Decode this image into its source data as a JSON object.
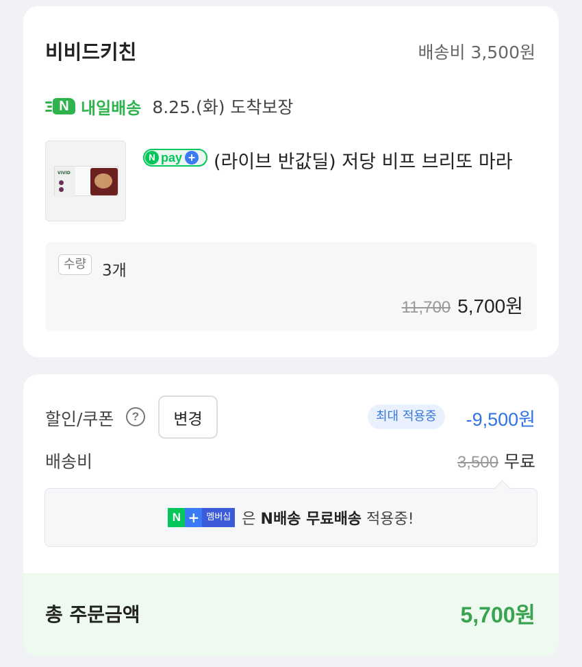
{
  "store": {
    "name": "비비드키친",
    "shipping_fee_label": "배송비 3,500원"
  },
  "delivery": {
    "badge_letter": "N",
    "label": "내일배송",
    "arrival": "8.25.(화) 도착보장",
    "color": "#2fb34c"
  },
  "product": {
    "thumbnail_logo": "VIVID",
    "npay_badge": {
      "n": "N",
      "pay": "pay",
      "plus": "+"
    },
    "title": "(라이브 반값딜) 저당 비프 브리또 마라"
  },
  "quantity": {
    "tag": "수량",
    "value": "3개",
    "original_price": "11,700",
    "final_price": "5,700원"
  },
  "summary": {
    "coupon_label": "할인/쿠폰",
    "help_icon": "?",
    "change_button": "변경",
    "max_badge": "최대 적용중",
    "discount": "-9,500원",
    "shipping_label": "배송비",
    "shipping_original": "3,500",
    "shipping_free": "무료"
  },
  "membership": {
    "n": "N",
    "plus": "+",
    "badge": "멤버십",
    "text_pre": "은",
    "text_bold": "N배송 무료배송",
    "text_post": "적용중!"
  },
  "total": {
    "label": "총 주문금액",
    "value": "5,700원",
    "color": "#3aa34f"
  },
  "colors": {
    "accent_green": "#03c75a",
    "accent_blue": "#2f73e6"
  }
}
